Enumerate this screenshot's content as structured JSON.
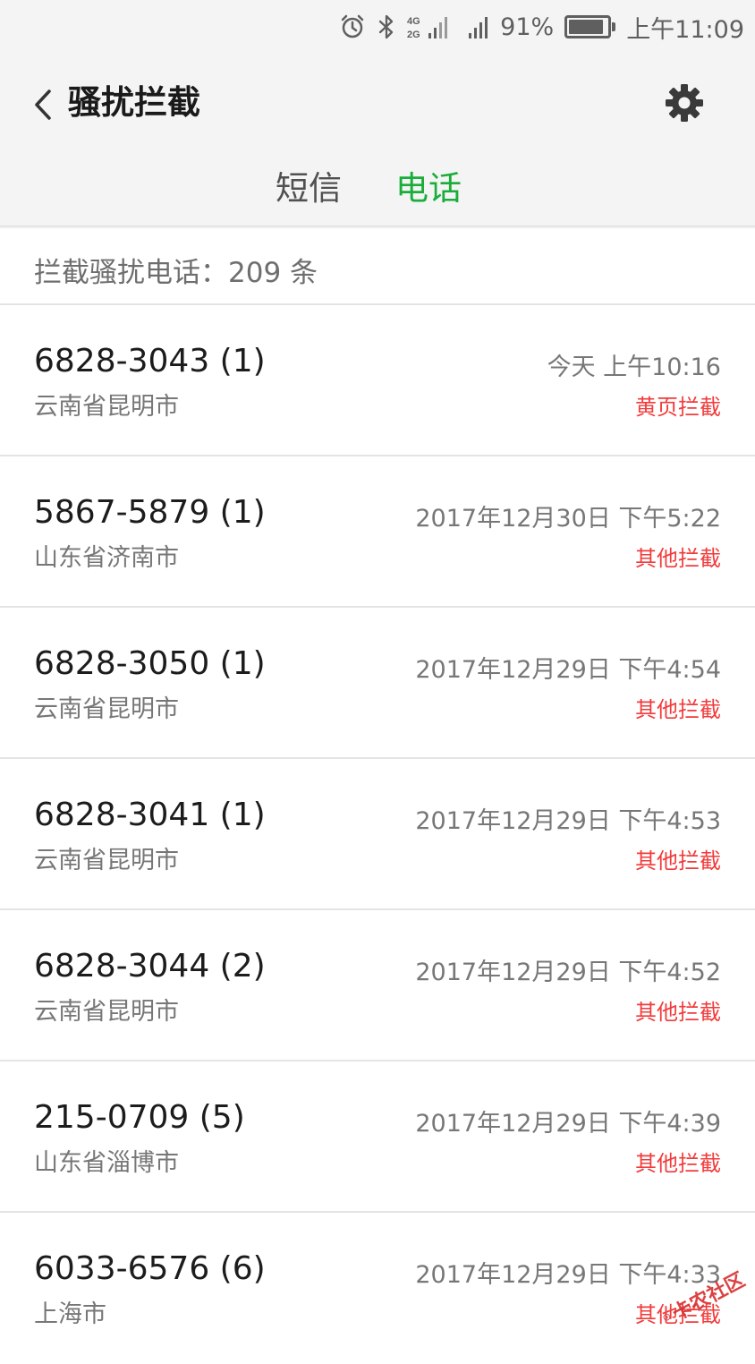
{
  "status_bar": {
    "network_top": "4G",
    "network_bottom": "2G",
    "battery_percent": "91%",
    "battery_level": 0.91,
    "time": "上午11:09"
  },
  "header": {
    "title": "骚扰拦截",
    "tabs": [
      {
        "label": "短信",
        "active": false
      },
      {
        "label": "电话",
        "active": true
      }
    ]
  },
  "summary": {
    "text": "拦截骚扰电话：209 条"
  },
  "calls": [
    {
      "number": "6828-3043 (1)",
      "location": "云南省昆明市",
      "time": "今天 上午10:16",
      "tag": "黄页拦截"
    },
    {
      "number": "5867-5879 (1)",
      "location": "山东省济南市",
      "time": "2017年12月30日 下午5:22",
      "tag": "其他拦截"
    },
    {
      "number": "6828-3050 (1)",
      "location": "云南省昆明市",
      "time": "2017年12月29日 下午4:54",
      "tag": "其他拦截"
    },
    {
      "number": "6828-3041 (1)",
      "location": "云南省昆明市",
      "time": "2017年12月29日 下午4:53",
      "tag": "其他拦截"
    },
    {
      "number": "6828-3044 (2)",
      "location": "云南省昆明市",
      "time": "2017年12月29日 下午4:52",
      "tag": "其他拦截"
    },
    {
      "number": "215-0709 (5)",
      "location": "山东省淄博市",
      "time": "2017年12月29日 下午4:39",
      "tag": "其他拦截"
    },
    {
      "number": "6033-6576 (6)",
      "location": "上海市",
      "time": "2017年12月29日 下午4:33",
      "tag": "其他拦截"
    }
  ],
  "watermark": {
    "text": "卡农社区"
  },
  "colors": {
    "active_tab": "#1aad3a",
    "tag_red": "#f23b3b",
    "header_bg": "#f4f4f4"
  }
}
